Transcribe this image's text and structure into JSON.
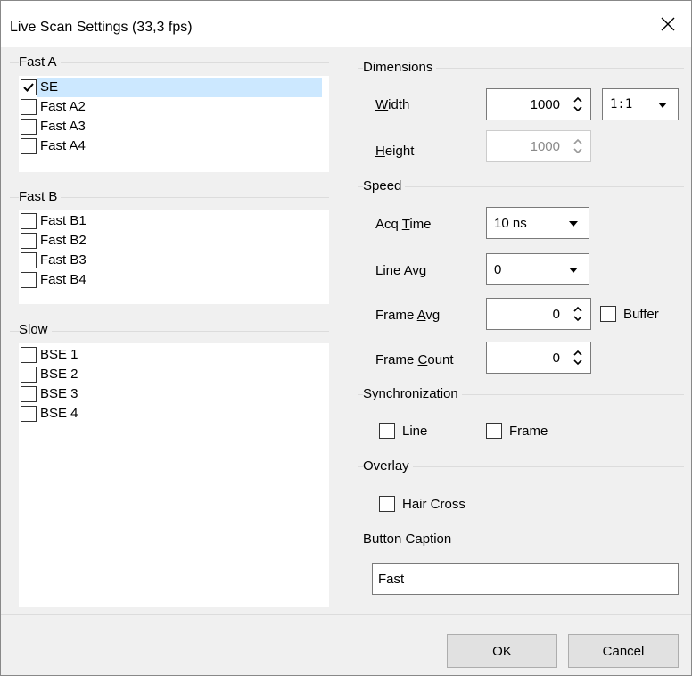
{
  "window": {
    "title": "Live Scan Settings (33,3 fps)"
  },
  "groups": {
    "fast_a": {
      "label": "Fast A",
      "items": [
        {
          "label": "SE",
          "checked": true,
          "selected": true
        },
        {
          "label": "Fast A2",
          "checked": false
        },
        {
          "label": "Fast A3",
          "checked": false
        },
        {
          "label": "Fast A4",
          "checked": false
        }
      ]
    },
    "fast_b": {
      "label": "Fast B",
      "items": [
        {
          "label": "Fast B1",
          "checked": false
        },
        {
          "label": "Fast B2",
          "checked": false
        },
        {
          "label": "Fast B3",
          "checked": false
        },
        {
          "label": "Fast B4",
          "checked": false
        }
      ]
    },
    "slow": {
      "label": "Slow",
      "items": [
        {
          "label": "BSE 1",
          "checked": false
        },
        {
          "label": "BSE 2",
          "checked": false
        },
        {
          "label": "BSE 3",
          "checked": false
        },
        {
          "label": "BSE 4",
          "checked": false
        }
      ]
    }
  },
  "dimensions": {
    "label": "Dimensions",
    "width_label_u": "W",
    "width_label_rest": "idth",
    "width_value": "1000",
    "ratio_value": "1:1",
    "height_label_u": "H",
    "height_label_rest": "eight",
    "height_value": "1000"
  },
  "speed": {
    "label": "Speed",
    "acq_time_pre": "Acq ",
    "acq_time_u": "T",
    "acq_time_rest": "ime",
    "acq_time_value": "10 ns",
    "line_avg_u": "L",
    "line_avg_rest": "ine Avg",
    "line_avg_value": "0",
    "frame_avg_pre": "Frame ",
    "frame_avg_u": "A",
    "frame_avg_rest": "vg",
    "frame_avg_value": "0",
    "buffer_label": "Buffer",
    "frame_count_pre": "Frame ",
    "frame_count_u": "C",
    "frame_count_rest": "ount",
    "frame_count_value": "0"
  },
  "synchronization": {
    "label": "Synchronization",
    "line_label": "Line",
    "frame_label": "Frame"
  },
  "overlay": {
    "label": "Overlay",
    "hair_cross_label": "Hair Cross"
  },
  "button_caption": {
    "label": "Button Caption",
    "value": "Fast"
  },
  "footer": {
    "ok_label": "OK",
    "cancel_label": "Cancel"
  }
}
